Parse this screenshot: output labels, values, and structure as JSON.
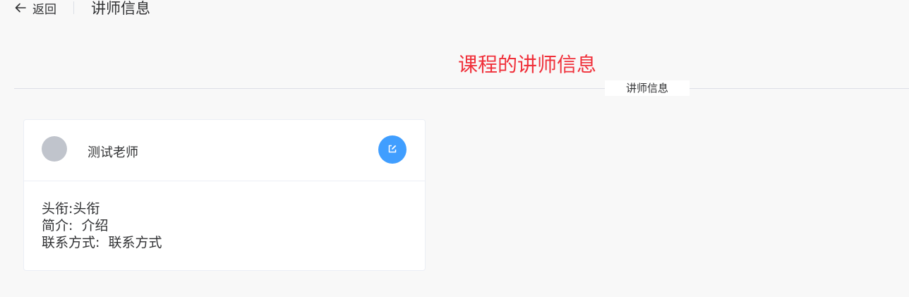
{
  "header": {
    "back_label": "返回",
    "title": "讲师信息"
  },
  "section": {
    "title": "课程的讲师信息",
    "divider_label": "讲师信息"
  },
  "card": {
    "name": "测试老师",
    "rows": [
      {
        "label": "头衔:",
        "value": "头衔"
      },
      {
        "label": "简介:",
        "value": "介绍"
      },
      {
        "label": "联系方式:",
        "value": "联系方式"
      }
    ]
  },
  "colors": {
    "title_red": "#f0303a",
    "primary_blue": "#409eff",
    "avatar_gray": "#c0c4cc"
  },
  "icons": {
    "back": "arrow-left-icon",
    "edit": "edit-icon"
  }
}
